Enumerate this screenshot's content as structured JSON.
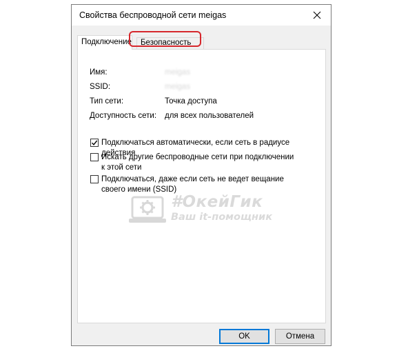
{
  "window": {
    "title": "Свойства беспроводной сети meigas",
    "close_icon": "close-icon"
  },
  "tabs": [
    {
      "label": "Подключение",
      "active": true
    },
    {
      "label": "Безопасность",
      "active": false,
      "highlighted": true
    }
  ],
  "info": [
    {
      "label": "Имя:",
      "value": "meigas",
      "blurred": true
    },
    {
      "label": "SSID:",
      "value": "meigas",
      "blurred": true
    },
    {
      "label": "Тип сети:",
      "value": "Точка доступа",
      "blurred": false
    },
    {
      "label": "Доступность сети:",
      "value": "для всех пользователей",
      "blurred": false
    }
  ],
  "options": [
    {
      "label": "Подключаться автоматически, если сеть в радиусе действия",
      "checked": true
    },
    {
      "label": "Искать другие беспроводные сети при подключении к этой сети",
      "checked": false
    },
    {
      "label": "Подключаться, даже если сеть не ведет вещание своего имени (SSID)",
      "checked": false
    }
  ],
  "watermark": {
    "title": "#ОкейГик",
    "subtitle": "Ваш it-помощник",
    "icon": "laptop-gear-icon"
  },
  "buttons": {
    "ok": "OK",
    "cancel": "Отмена"
  },
  "colors": {
    "highlight": "#d6262b",
    "default_button_border": "#0078d7",
    "dialog_bg": "#f0f0f0"
  }
}
